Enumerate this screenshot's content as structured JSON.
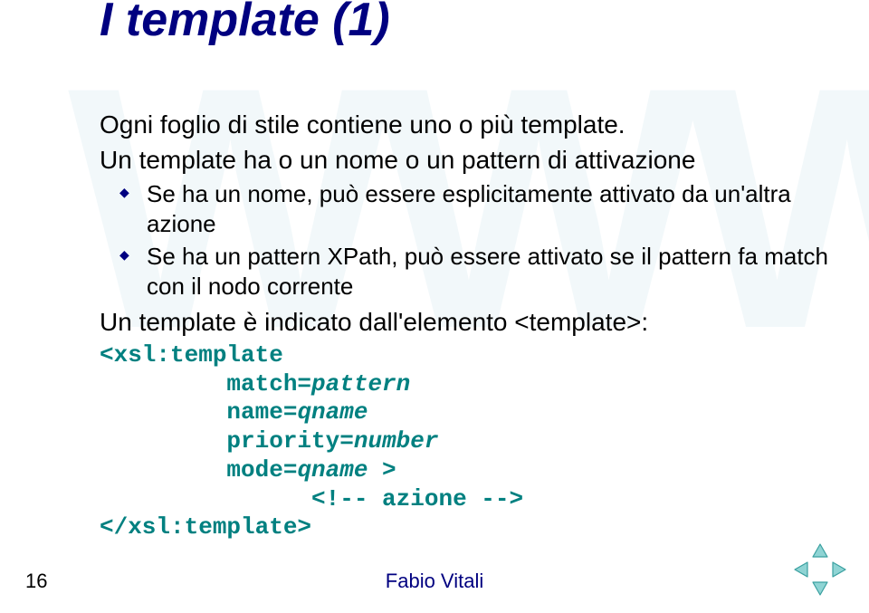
{
  "watermark": "WWW",
  "title": "I template (1)",
  "paragraph1": "Ogni foglio di stile contiene uno o più template.",
  "paragraph2": "Un template ha o un nome o un pattern di attivazione",
  "bullets": [
    "Se ha un nome, può essere esplicitamente attivato da un'altra azione",
    "Se ha un pattern XPath, può essere attivato se il pattern fa match con il nodo corrente"
  ],
  "paragraph3": "Un template è indicato dall'elemento <template>:",
  "code": {
    "l1": "<xsl:template",
    "l2a": "         match=",
    "l2b": "pattern",
    "l3a": "         name=",
    "l3b": "qname",
    "l4a": "         priority=",
    "l4b": "number",
    "l5a": "         mode=",
    "l5b": "qname",
    "l5c": " >",
    "l6": "               <!-- azione -->",
    "l7": "</xsl:template>"
  },
  "pageNumber": "16",
  "author": "Fabio Vitali"
}
